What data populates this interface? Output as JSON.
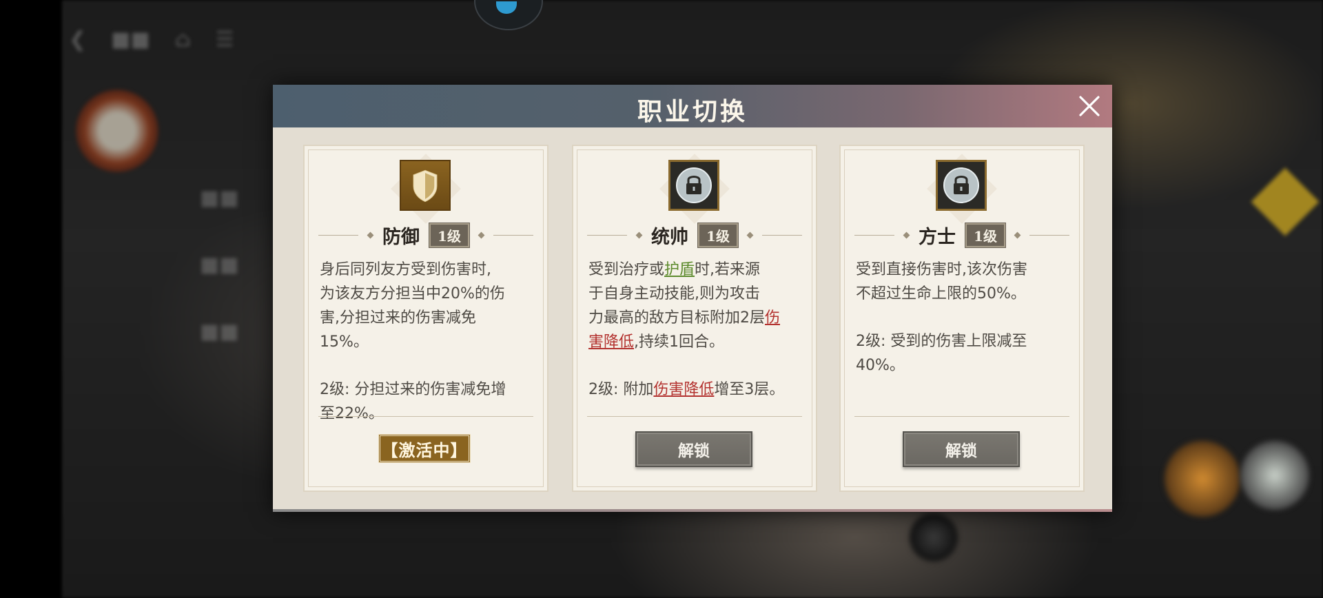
{
  "dialog": {
    "title": "职业切换",
    "close_icon": "close-icon"
  },
  "cards": [
    {
      "icon": "shield-icon",
      "name": "防御",
      "level": "1级",
      "desc_lines": [
        "身后同列友方受到伤害时,",
        "为该友方分担当中20%的伤",
        "害,分担过来的伤害减免",
        "15%。"
      ],
      "upgrade_lines": [
        "2级: 分担过来的伤害减免增",
        "至22%。"
      ],
      "status": "【激活中】"
    },
    {
      "icon": "lock-icon",
      "name": "统帅",
      "level": "1级",
      "desc": {
        "l1_a": "受到治疗或",
        "l1_hl": "护盾",
        "l1_b": "时,若来源",
        "l2": "于自身主动技能,则为攻击",
        "l3_a": "力最高的敌方目标附加2层",
        "l3_hl": "伤",
        "l4_hl": "害降低",
        "l4_b": ",持续1回合。"
      },
      "upgrade": {
        "a": "2级: 附加",
        "hl": "伤害降低",
        "b": "增至3层。"
      },
      "button": "解锁"
    },
    {
      "icon": "lock-icon",
      "name": "方士",
      "level": "1级",
      "desc_lines": [
        "受到直接伤害时,该次伤害",
        "不超过生命上限的50%。"
      ],
      "upgrade_lines": [
        "2级: 受到的伤害上限减至",
        "40%。"
      ],
      "button": "解锁"
    }
  ],
  "colors": {
    "header_left": "#4d5f6e",
    "header_right": "#b27a80",
    "card_bg": "#f5f1e8",
    "active_badge": "#8a6420",
    "unlock_button": "#6b6862",
    "highlight_green": "#5c8a2c",
    "highlight_red": "#b3322f"
  }
}
